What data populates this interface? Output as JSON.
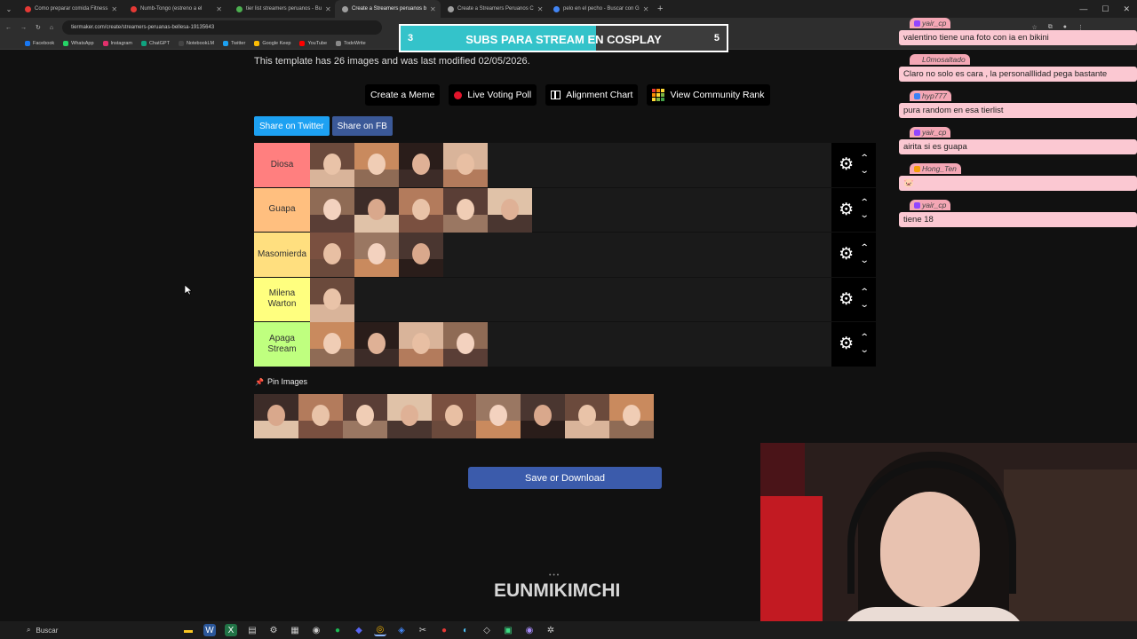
{
  "browser": {
    "tabs": [
      {
        "label": "Como preparar comida Fitness",
        "color": "#e53935"
      },
      {
        "label": "Numb-Tongo (estreno a el",
        "color": "#e53935"
      },
      {
        "label": "tier list streamers peruanos - Bu",
        "color": "#4caf50"
      },
      {
        "label": "Create a Streamers peruanos b",
        "color": "#9e9e9e",
        "active": true
      },
      {
        "label": "Create a Streamers Peruanos C",
        "color": "#9e9e9e"
      },
      {
        "label": "pelo en el pecho - Buscar con G",
        "color": "#4285f4"
      }
    ],
    "url": "tiermaker.com/create/streamers-peruanas-bellesa-19135643",
    "bookmarks": [
      "Facebook",
      "WhatsApp",
      "Instagram",
      "ChatGPT",
      "NotebookLM",
      "Twitter",
      "Google Keep",
      "YouTube",
      "TodoWrite"
    ]
  },
  "page": {
    "info": "This template has 26 images and was last modified 02/05/2026.",
    "actions": {
      "create_meme": "Create a Meme",
      "live_voting": "Live Voting Poll",
      "alignment": "Alignment Chart",
      "community": "View Community Rank"
    },
    "share": {
      "twitter": "Share on Twitter",
      "facebook": "Share on FB",
      "twitter_color": "#1da1f2",
      "facebook_color": "#3b5998"
    },
    "tiers": [
      {
        "label": "Diosa",
        "color": "#ff7f7f",
        "count": 4
      },
      {
        "label": "Guapa",
        "color": "#ffbf7f",
        "count": 5
      },
      {
        "label": "Masomierda",
        "color": "#ffdf7f",
        "count": 3
      },
      {
        "label": "Milena Warton",
        "color": "#ffff7f",
        "count": 1
      },
      {
        "label": "Apaga Stream",
        "color": "#bfff7f",
        "count": 4
      }
    ],
    "pin_label": "Pin Images",
    "pinned_count": 9,
    "save_button": "Save or Download",
    "watermark": "EUNMIKIMCHI"
  },
  "overlay": {
    "goal": {
      "left": "3",
      "text": "SUBS PARA STREAM EN COSPLAY",
      "right": "5",
      "progress": 0.6
    },
    "chat": [
      {
        "user": "yair_cp",
        "text": "valentino tiene una foto con ia en bikini"
      },
      {
        "user": "L0mosaltado",
        "text": "Claro no solo es cara , la personalllidad pega bastante"
      },
      {
        "user": "hyp777",
        "text": "pura random en esa tierlist"
      },
      {
        "user": "yair_cp",
        "text": "airita si es guapa"
      },
      {
        "user": "Hong_Ten",
        "text": "🐷"
      },
      {
        "user": "yair_cp",
        "text": "tiene 18"
      }
    ]
  },
  "taskbar": {
    "search": "Buscar"
  }
}
